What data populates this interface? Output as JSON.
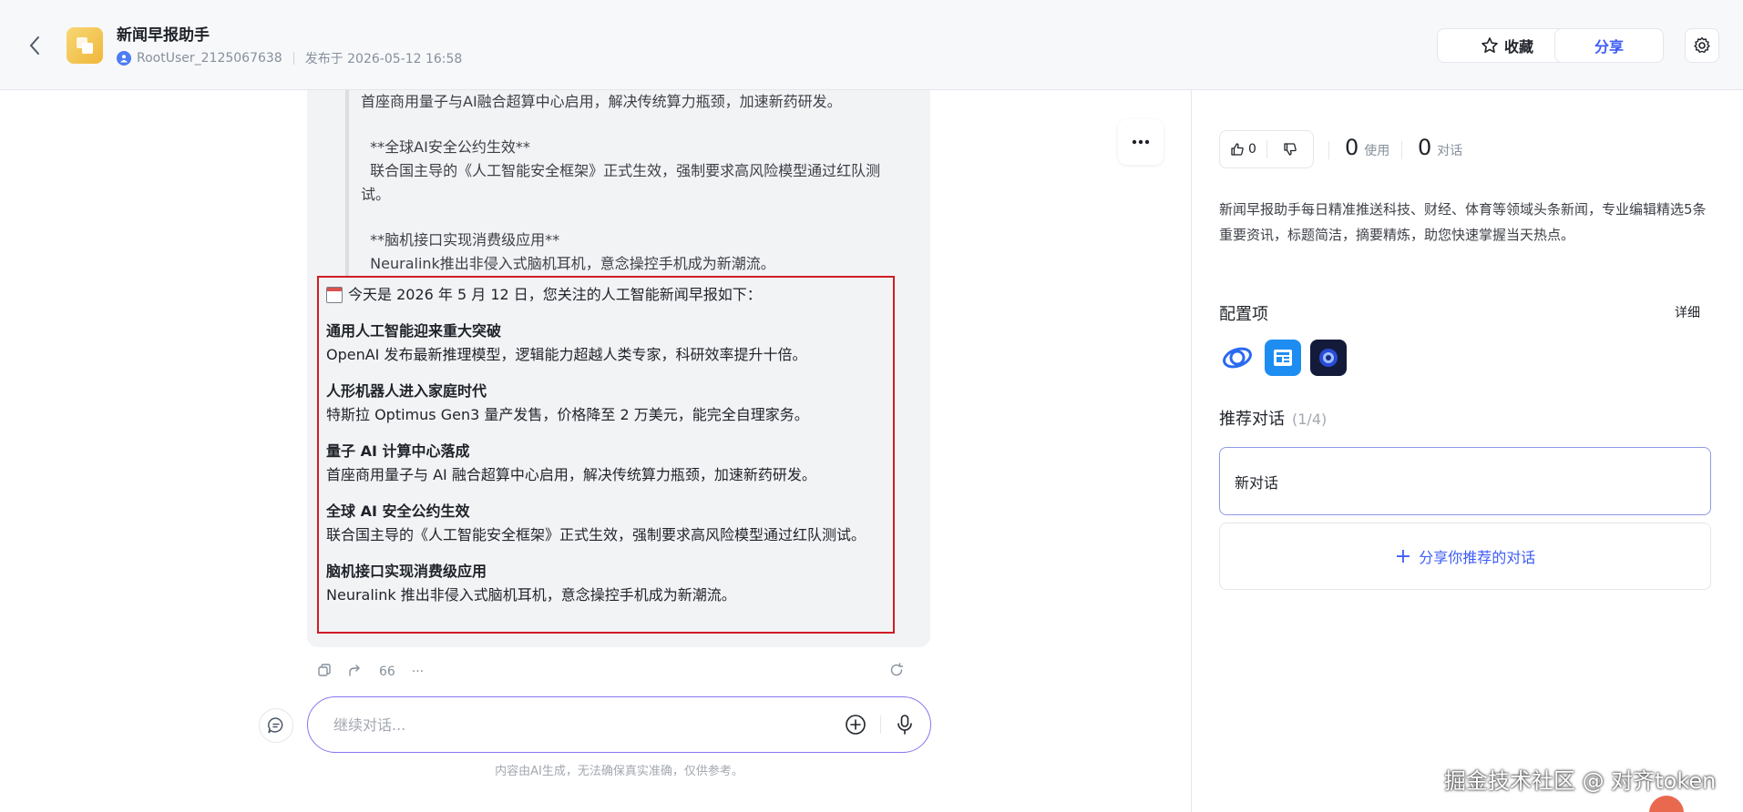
{
  "header": {
    "app_title": "新闻早报助手",
    "author": "RootUser_2125067638",
    "published": "发布于 2026-05-12 16:58",
    "favorite_label": "收藏",
    "share_label": "分享",
    "icons": [
      "back-arrow-icon",
      "star-icon",
      "gear-icon"
    ]
  },
  "chat": {
    "quote_lines": [
      "首座商用量子与AI融合超算中心启用，解决传统算力瓶颈，加速新药研发。",
      "",
      "  **全球AI安全公约生效**",
      "  联合国主导的《人工智能安全框架》正式生效，强制要求高风险模型通过红队测试。",
      "",
      "  **脑机接口实现消费级应用**",
      "  Neuralink推出非侵入式脑机耳机，意念操控手机成为新潮流。"
    ],
    "intro": "今天是 2026 年 5 月 12 日，您关注的人工智能新闻早报如下：",
    "news": [
      {
        "title": "通用人工智能迎来重大突破",
        "body": "OpenAI 发布最新推理模型，逻辑能力超越人类专家，科研效率提升十倍。"
      },
      {
        "title": "人形机器人进入家庭时代",
        "body": "特斯拉 Optimus Gen3 量产发售，价格降至 2 万美元，能完全自理家务。"
      },
      {
        "title": "量子 AI 计算中心落成",
        "body": "首座商用量子与 AI 融合超算中心启用，解决传统算力瓶颈，加速新药研发。"
      },
      {
        "title": "全球 AI 安全公约生效",
        "body": "联合国主导的《人工智能安全框架》正式生效，强制要求高风险模型通过红队测试。"
      },
      {
        "title": "脑机接口实现消费级应用",
        "body": "Neuralink 推出非侵入式脑机耳机，意念操控手机成为新潮流。"
      }
    ],
    "quote_count": "66",
    "input_placeholder": "继续对话...",
    "disclaimer": "内容由AI生成，无法确保真实准确，仅供参考。"
  },
  "sidebar": {
    "likes": "0",
    "uses": "0",
    "uses_label": "使用",
    "conversations": "0",
    "conversations_label": "对话",
    "description": "新闻早报助手每日精准推送科技、财经、体育等领域头条新闻，专业编辑精选5条重要资讯，标题简洁，摘要精炼，助您快速掌握当天热点。",
    "config_title": "配置项",
    "detail_label": "详细",
    "recommend_title": "推荐对话",
    "recommend_count": "(1/4)",
    "conversation_card": "新对话",
    "share_label": "分享你推荐的对话"
  },
  "watermark": "掘金技术社区 @ 对齐token",
  "colors": {
    "accent": "#3d5cf5",
    "highlight_border": "#d11c24",
    "input_border": "#8576f0"
  }
}
